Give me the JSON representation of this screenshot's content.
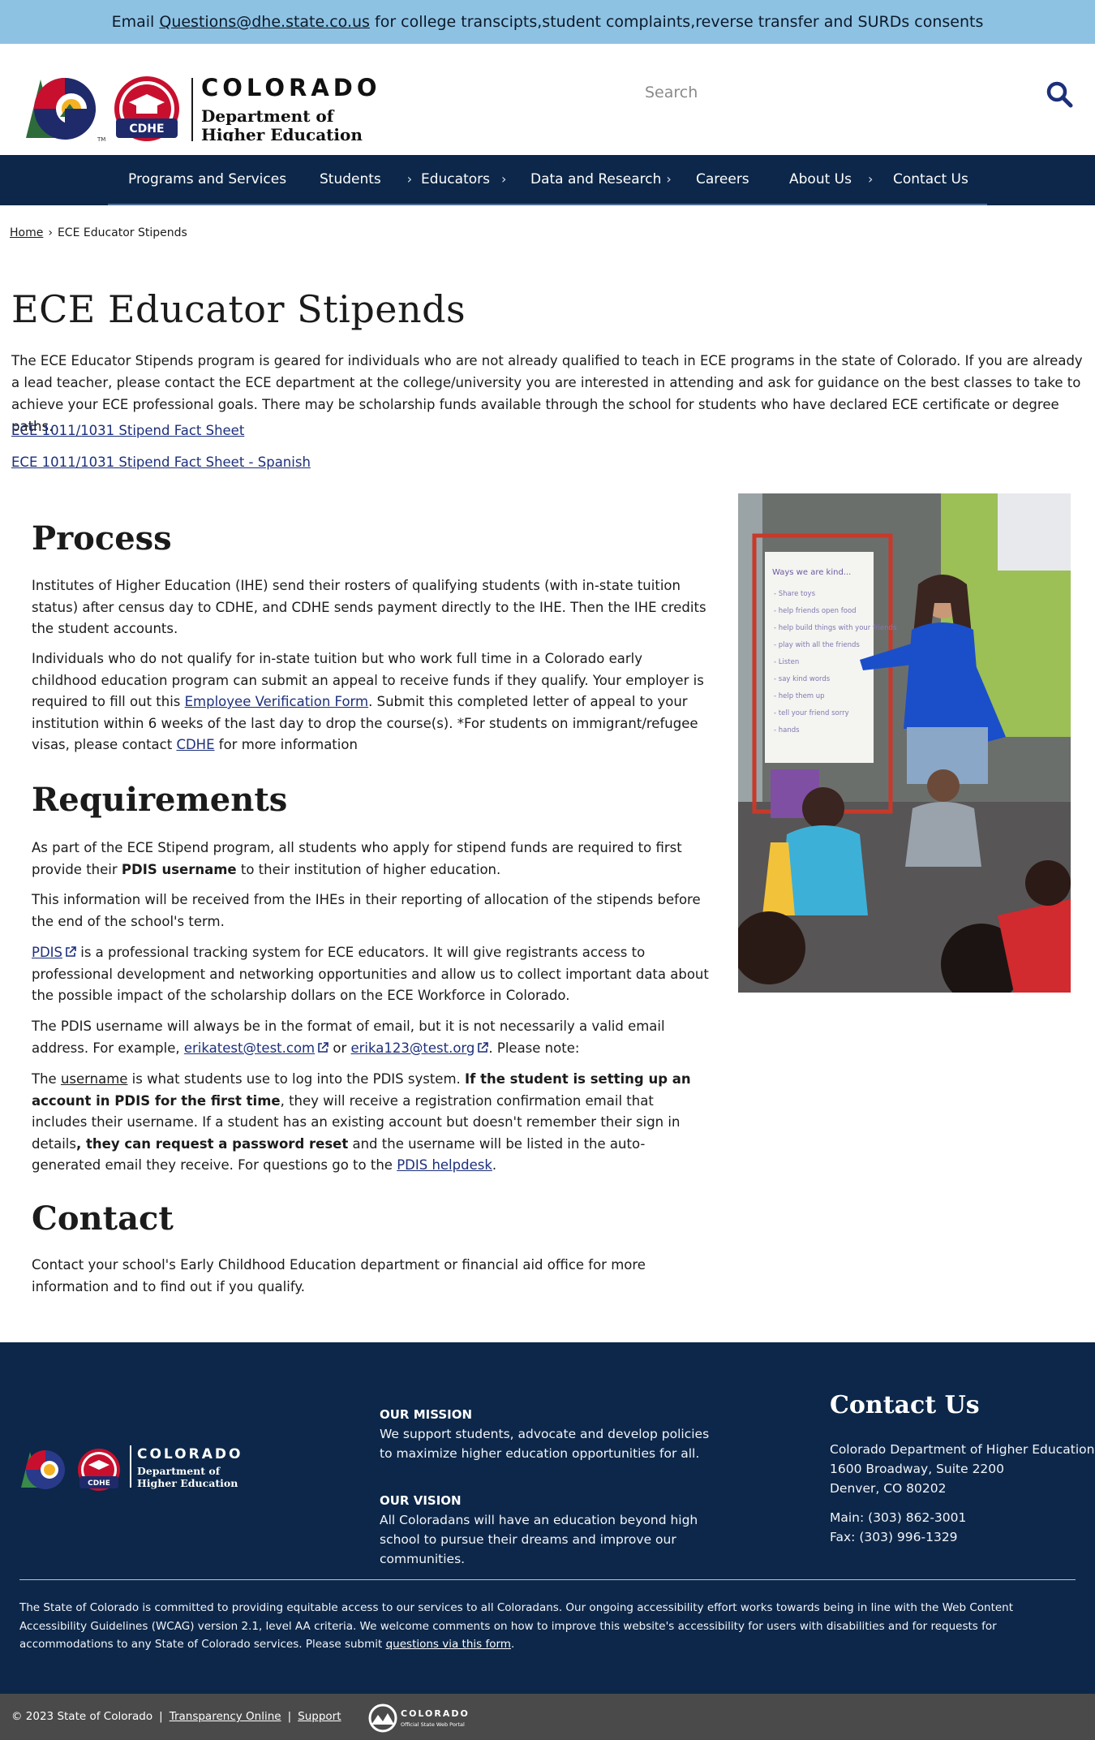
{
  "alert": {
    "prefix": "Email ",
    "email": "Questions@dhe.state.co.us",
    "suffix": " for college transcipts,student complaints,reverse transfer and SURDs consents"
  },
  "header": {
    "logo": {
      "state": "COLORADO",
      "dept_line1": "Department of",
      "dept_line2": "Higher Education",
      "badge": "CDHE",
      "tm": "TM"
    },
    "search": {
      "placeholder": "Search"
    }
  },
  "nav": {
    "items": [
      {
        "label": "Programs and Services",
        "chevron": false
      },
      {
        "label": "Students",
        "chevron": true
      },
      {
        "label": "Educators",
        "chevron": true
      },
      {
        "label": "Data and Research",
        "chevron": true
      },
      {
        "label": "Careers",
        "chevron": false
      },
      {
        "label": "About Us",
        "chevron": true
      },
      {
        "label": "Contact Us",
        "chevron": false
      }
    ],
    "chevron_glyph": "›"
  },
  "breadcrumb": {
    "home": "Home",
    "separator": "›",
    "current": "ECE Educator Stipends"
  },
  "main": {
    "title": "ECE Educator Stipends",
    "intro": "The ECE Educator Stipends program is geared for individuals who are not already qualified to teach in ECE programs in the state of Colorado. If you are already a lead teacher, please contact the ECE department at the college/university you are interested in attending and ask for guidance on the best classes to take to achieve your ECE professional goals. There may be scholarship funds available through the school for students who have declared ECE certificate or degree paths.",
    "fact_sheet": "ECE 1011/1031 Stipend Fact Sheet",
    "fact_sheet_spanish": "ECE 1011/1031 Stipend Fact Sheet - Spanish",
    "process": {
      "title": "Process",
      "p1": "Institutes of Higher Education (IHE) send their rosters of qualifying students (with in-state tuition status) after census day to CDHE, and CDHE sends payment directly to the IHE. Then the IHE credits the student accounts.",
      "p2_a": "Individuals who do not qualify for in-state tuition but who work full time in a Colorado early childhood education program can submit an appeal to receive funds if they qualify. Your employer is required to fill out this ",
      "p2_link": "Employee Verification Form",
      "p2_b": ". Submit this completed letter of appeal to your institution within 6 weeks of the last day to drop the course(s). *For students on immigrant/refugee visas, please contact ",
      "p2_cdhe": "CDHE",
      "p2_c": " for more information"
    },
    "requirements": {
      "title": "Requirements",
      "p1_a": "As part of the ECE Stipend program, all students who apply for stipend funds are required to first provide their ",
      "p1_bold": "PDIS username",
      "p1_b": " to their institution of higher education.",
      "p2": "This information will be received from the IHEs in their reporting of allocation of the stipends before the end of the school's term.",
      "p3_link": "PDIS",
      "p3_rest": " is a professional tracking system for ECE educators. It will give registrants access to professional development and networking opportunities and allow us to collect important data about the possible impact of the scholarship dollars on the ECE Workforce in Colorado.",
      "p4_a": "The PDIS username will always be in the format of email, but it is not necessarily a valid email address. For example, ",
      "p4_email1": "erikatest@test.com",
      "p4_or": " or ",
      "p4_email2": "erika123@test.org",
      "p4_b": ". Please note:",
      "p5_a": "The ",
      "p5_username": "username",
      "p5_b": " is what students use to log into the PDIS system. ",
      "p5_bold1": "If the student is setting up an account in PDIS for the first time",
      "p5_c": ", they will receive a registration confirmation email that includes their username. If a student has an existing account but doesn't remember their sign in details",
      "p5_bold2": ", they can request a password reset",
      "p5_d": " and the username will be listed in the auto-generated email they receive. For questions go to the ",
      "p5_help": "PDIS helpdesk",
      "p5_e": "."
    },
    "contact": {
      "title": "Contact",
      "p1": "Contact your school's Early Childhood Education department or financial aid office for more information and to find out if you qualify."
    },
    "photo": {
      "chart_title": "Ways we are kind...",
      "chart_lines": [
        "Share toys",
        "help friends open food",
        "help build things with your friends",
        "play with all the friends",
        "Listen",
        "say kind words",
        "help them up",
        "tell your friend sorry",
        "hands"
      ]
    }
  },
  "footer": {
    "mission_head": "OUR MISSION",
    "mission_text": "We support students, advocate and develop policies to maximize higher education opportunities for all.",
    "vision_head": "OUR VISION",
    "vision_text": "All Coloradans will have an education beyond high school to pursue their dreams and improve our communities.",
    "contact_title": "Contact Us",
    "org": "Colorado Department of Higher Education",
    "address1": "1600 Broadway, Suite 2200",
    "address2": "Denver, CO 80202",
    "main": "Main: (303) 862-3001",
    "fax": "Fax: (303) 996-1329",
    "access_text": "The State of Colorado is committed to providing equitable access to our services to all Coloradans. Our ongoing accessibility effort works towards being in line with the Web Content Accessibility Guidelines (WCAG) version 2.1, level AA criteria. We welcome comments on how to improve this website's accessibility for users with disabilities and for requests for accommodations to any State of Colorado services. Please submit ",
    "access_link": "questions via this form",
    "access_end": ".",
    "copyright": "© 2023 State of Colorado",
    "sep": "|",
    "transparency": "Transparency Online",
    "support": "Support",
    "portal_state": "COLORADO",
    "portal_sub": "Official State Web Portal"
  },
  "colors": {
    "navy": "#0c2749",
    "alert_blue": "#8ec2e3",
    "link": "#1c2f7a",
    "bottom_bar": "#4a4a4a"
  }
}
